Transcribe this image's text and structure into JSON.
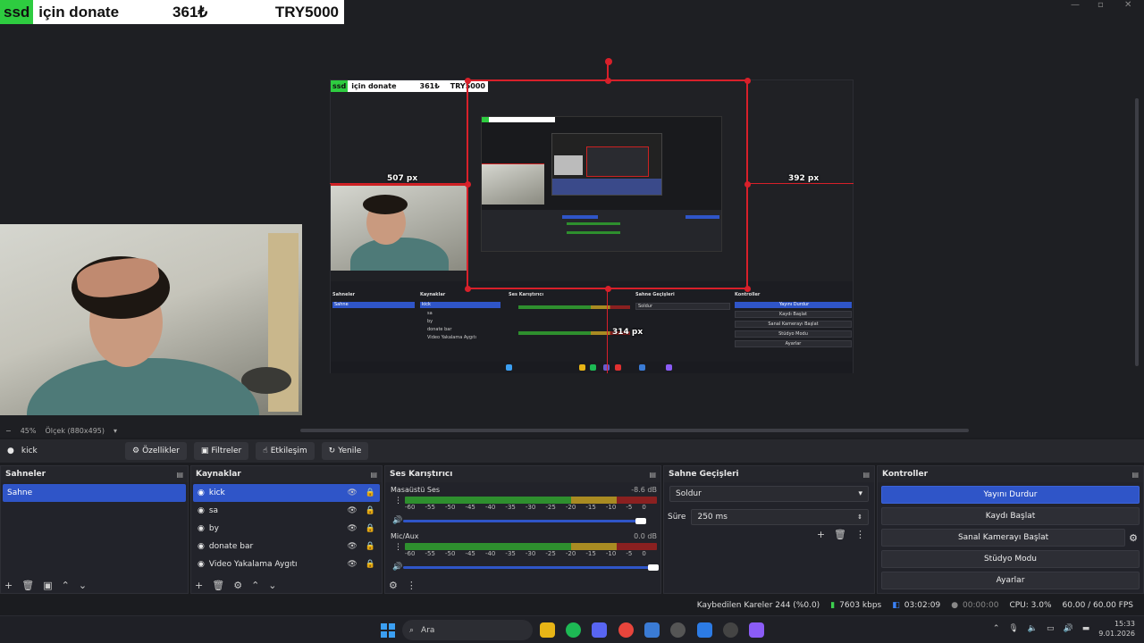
{
  "overlay": {
    "tag": "ssd",
    "label": "için donate",
    "amount": "361₺",
    "total": "TRY5000"
  },
  "preview": {
    "px_left": "507 px",
    "px_right": "392 px",
    "px_bottom": "314 px",
    "zoom_minus": "−",
    "zoom_level": "45%",
    "scale_label": "Ölçek (880x495)"
  },
  "source_toolbar": {
    "source_name": "kick",
    "properties": "Özellikler",
    "filters": "Filtreler",
    "interact": "Etkileşim",
    "refresh": "Yenile"
  },
  "scenes": {
    "title": "Sahneler",
    "items": [
      "Sahne"
    ]
  },
  "sources": {
    "title": "Kaynaklar",
    "items": [
      "kick",
      "sa",
      "by",
      "donate bar",
      "Video Yakalama Aygıtı"
    ]
  },
  "mixer": {
    "title": "Ses Karıştırıcı",
    "tracks": [
      {
        "name": "Masaüstü Ses",
        "db": "-8.6 dB",
        "volume_fraction": 0.95
      },
      {
        "name": "Mic/Aux",
        "db": "0.0 dB",
        "volume_fraction": 1.0
      }
    ],
    "scale": [
      "-60",
      "-55",
      "-50",
      "-45",
      "-40",
      "-35",
      "-30",
      "-25",
      "-20",
      "-15",
      "-10",
      "-5",
      "0"
    ]
  },
  "transitions": {
    "title": "Sahne Geçişleri",
    "selected": "Soldur",
    "duration_label": "Süre",
    "duration_value": "250 ms"
  },
  "controls": {
    "title": "Kontroller",
    "stop_stream": "Yayını Durdur",
    "start_record": "Kaydı Başlat",
    "virtual_cam": "Sanal Kamerayı Başlat",
    "studio_mode": "Stüdyo Modu",
    "settings": "Ayarlar"
  },
  "status": {
    "dropped": "Kaybedilen Kareler 244 (%0.0)",
    "bitrate": "7603 kbps",
    "stream_time": "03:02:09",
    "record_time": "00:00:00",
    "cpu": "CPU: 3.0%",
    "fps": "60.00 / 60.00 FPS"
  },
  "taskbar": {
    "search_placeholder": "Ara",
    "time": "15:33",
    "date": "9.01.2026"
  },
  "colors": {
    "accent": "#2f55c8",
    "selection_red": "#d8202a",
    "donate_green": "#2ecc40"
  },
  "nested": {
    "donate_tag": "ssd",
    "donate_label": "için donate",
    "donate_amount": "361₺",
    "donate_total": "TRY5000"
  }
}
